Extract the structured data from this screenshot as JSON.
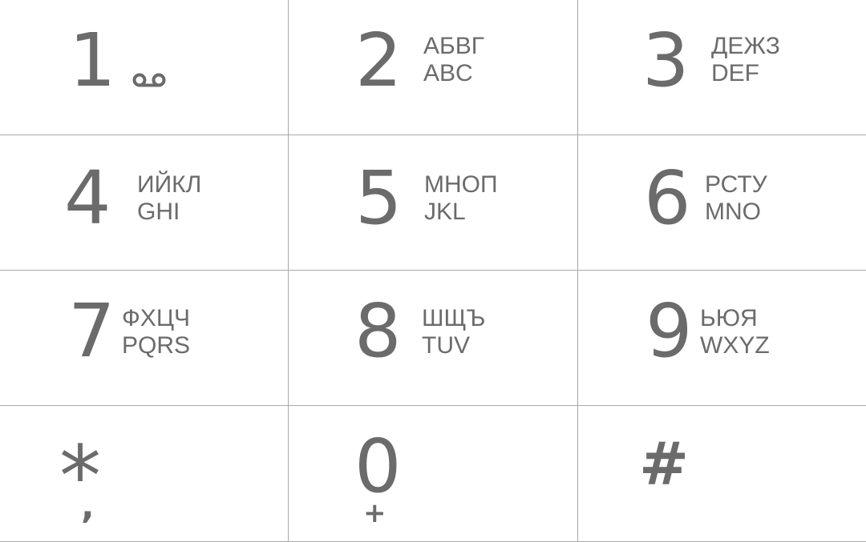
{
  "keypad": {
    "keys": [
      {
        "digit": "1",
        "cyrillic": "",
        "latin": "",
        "sub": "voicemail"
      },
      {
        "digit": "2",
        "cyrillic": "АБВГ",
        "latin": "ABC"
      },
      {
        "digit": "3",
        "cyrillic": "ДЕЖЗ",
        "latin": "DEF"
      },
      {
        "digit": "4",
        "cyrillic": "ИЙКЛ",
        "latin": "GHI"
      },
      {
        "digit": "5",
        "cyrillic": "МНОП",
        "latin": "JKL"
      },
      {
        "digit": "6",
        "cyrillic": "РСТУ",
        "latin": "MNO"
      },
      {
        "digit": "7",
        "cyrillic": "ФХЦЧ",
        "latin": "PQRS"
      },
      {
        "digit": "8",
        "cyrillic": "ШЩЪ",
        "latin": "TUV"
      },
      {
        "digit": "9",
        "cyrillic": "ЬЮЯ",
        "latin": "WXYZ"
      },
      {
        "digit": "*",
        "sub": ","
      },
      {
        "digit": "0",
        "sub": "+"
      },
      {
        "digit": "#"
      }
    ],
    "colors": {
      "text": "#6b6b6b",
      "divider": "#a8a8a8",
      "background": "#ffffff"
    },
    "icons": {
      "voicemail": "voicemail-icon"
    }
  }
}
